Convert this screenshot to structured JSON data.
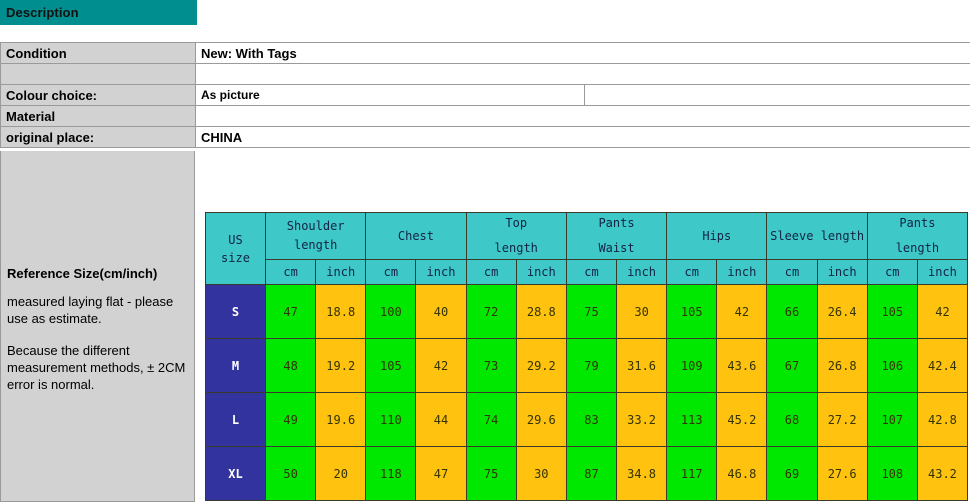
{
  "tab": {
    "label": "Description"
  },
  "info": {
    "rows": [
      {
        "label": "Condition",
        "value": "New: With Tags",
        "split": false,
        "value2": ""
      },
      {
        "label": "",
        "value": "",
        "split": false,
        "value2": ""
      },
      {
        "label": "Colour choice:",
        "value": "As picture",
        "split": true,
        "value2": ""
      },
      {
        "label": "Material",
        "value": "",
        "split": false,
        "value2": ""
      },
      {
        "label": "original place:",
        "value": "CHINA",
        "split": false,
        "value2": ""
      }
    ]
  },
  "notes": {
    "title": "Reference Size(cm/inch)",
    "paragraph1": "measured laying flat - please use as estimate.",
    "paragraph2": "Because the different measurement methods, ± 2CM error is normal."
  },
  "size_chart": {
    "us_size_header": {
      "line1": "US",
      "line2": "size"
    },
    "groups": [
      {
        "line1": "Shoulder",
        "line2": "length",
        "spaced": false
      },
      {
        "line1": "Chest",
        "line2": "",
        "spaced": false
      },
      {
        "line1": "Top",
        "line2": "length",
        "spaced": true
      },
      {
        "line1": "Pants",
        "line2": "Waist",
        "spaced": true
      },
      {
        "line1": "Hips",
        "line2": "",
        "spaced": false
      },
      {
        "line1": "Sleeve length",
        "line2": "",
        "spaced": false
      },
      {
        "line1": "Pants",
        "line2": "length",
        "spaced": true
      }
    ],
    "units": [
      "cm",
      "inch",
      "cm",
      "inch",
      "cm",
      "inch",
      "cm",
      "inch",
      "cm",
      "inch",
      "cm",
      "inch",
      "cm",
      "inch"
    ],
    "rows": [
      {
        "size": "S",
        "values": [
          "47",
          "18.8",
          "100",
          "40",
          "72",
          "28.8",
          "75",
          "30",
          "105",
          "42",
          "66",
          "26.4",
          "105",
          "42"
        ]
      },
      {
        "size": "M",
        "values": [
          "48",
          "19.2",
          "105",
          "42",
          "73",
          "29.2",
          "79",
          "31.6",
          "109",
          "43.6",
          "67",
          "26.8",
          "106",
          "42.4"
        ]
      },
      {
        "size": "L",
        "values": [
          "49",
          "19.6",
          "110",
          "44",
          "74",
          "29.6",
          "83",
          "33.2",
          "113",
          "45.2",
          "68",
          "27.2",
          "107",
          "42.8"
        ]
      },
      {
        "size": "XL",
        "values": [
          "50",
          "20",
          "118",
          "47",
          "75",
          "30",
          "87",
          "34.8",
          "117",
          "46.8",
          "69",
          "27.6",
          "108",
          "43.2"
        ]
      }
    ]
  },
  "colors": {
    "tab_teal": "#008E8E",
    "header_teal": "#3FC8C8",
    "size_blue": "#3333A0",
    "cm_green": "#00E800",
    "inch_orange": "#FFC20E",
    "panel_gray": "#d2d2d2"
  }
}
